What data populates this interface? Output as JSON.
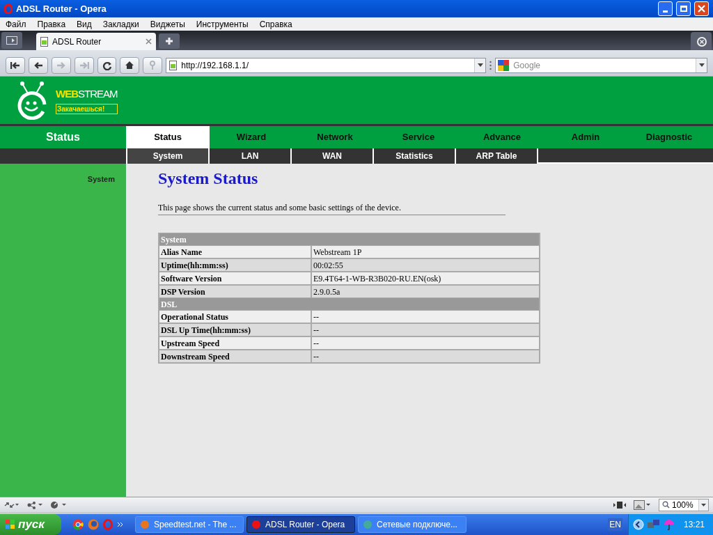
{
  "window": {
    "title": "ADSL Router - Opera"
  },
  "menu": [
    "Файл",
    "Правка",
    "Вид",
    "Закладки",
    "Виджеты",
    "Инструменты",
    "Справка"
  ],
  "tabs": [
    {
      "label": "ADSL Router",
      "selected": true
    }
  ],
  "address": {
    "value": "http://192.168.1.1/"
  },
  "search": {
    "placeholder": "Google"
  },
  "page": {
    "logo": {
      "word_1": "WEB",
      "word_2": "STREAM",
      "slogan": "Закачаешься!"
    },
    "section_title": "Status",
    "nav": [
      {
        "label": "Status",
        "selected": true
      },
      {
        "label": "Wizard",
        "selected": false
      },
      {
        "label": "Network",
        "selected": false
      },
      {
        "label": "Service",
        "selected": false
      },
      {
        "label": "Advance",
        "selected": false
      },
      {
        "label": "Admin",
        "selected": false
      },
      {
        "label": "Diagnostic",
        "selected": false
      }
    ],
    "subnav": [
      {
        "label": "System",
        "selected": true
      },
      {
        "label": "LAN",
        "selected": false
      },
      {
        "label": "WAN",
        "selected": false
      },
      {
        "label": "Statistics",
        "selected": false
      },
      {
        "label": "ARP Table",
        "selected": false
      }
    ],
    "sidebar": {
      "items": [
        "System"
      ]
    },
    "heading": "System Status",
    "description": "This page shows the current status and some basic settings of the device.",
    "table": [
      {
        "kind": "header",
        "label": "System"
      },
      {
        "kind": "row",
        "label": "Alias Name",
        "value": "Webstream 1P"
      },
      {
        "kind": "row",
        "label": "Uptime(hh:mm:ss)",
        "value": "00:02:55"
      },
      {
        "kind": "row",
        "label": "Software Version",
        "value": "E9.4T64-1-WB-R3B020-RU.EN(osk)"
      },
      {
        "kind": "row",
        "label": "DSP Version",
        "value": "2.9.0.5a"
      },
      {
        "kind": "header",
        "label": "DSL"
      },
      {
        "kind": "row",
        "label": "Operational Status",
        "value": "--"
      },
      {
        "kind": "row",
        "label": "DSL Up Time(hh:mm:ss)",
        "value": "--"
      },
      {
        "kind": "row",
        "label": "Upstream Speed",
        "value": "--"
      },
      {
        "kind": "row",
        "label": "Downstream Speed",
        "value": "--"
      }
    ]
  },
  "status_bar": {
    "zoom": "100%"
  },
  "taskbar": {
    "start": "пуск",
    "tasks": [
      {
        "label": "Speedtest.net - The ...",
        "selected": false
      },
      {
        "label": "ADSL Router - Opera",
        "selected": true
      },
      {
        "label": "Сетевые подключе...",
        "selected": false
      }
    ],
    "language": "EN",
    "clock": "13:21"
  }
}
